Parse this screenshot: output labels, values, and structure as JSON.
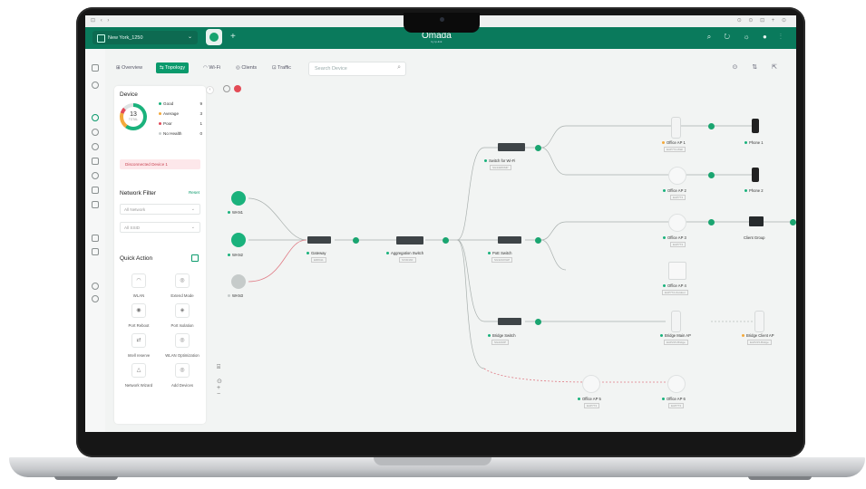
{
  "browser": {
    "left_icons": "⊡ ‹ ›",
    "right_icons": "⊙ ⊙ ⊡ + ⊙"
  },
  "header": {
    "site": "New York_1250",
    "brand": "Omada",
    "brand_sub": "by tp-link"
  },
  "tabs": [
    {
      "label": "Overview",
      "icon": "grid-icon"
    },
    {
      "label": "Topology",
      "icon": "topology-icon",
      "active": true
    },
    {
      "label": "Wi-Fi",
      "icon": "wifi-icon"
    },
    {
      "label": "Clients",
      "icon": "clients-icon"
    },
    {
      "label": "Traffic",
      "icon": "traffic-icon"
    }
  ],
  "search": {
    "placeholder": "Search Device"
  },
  "device_panel": {
    "title": "Device",
    "total": "13",
    "total_label": "TOTAL",
    "legend": [
      {
        "label": "Good",
        "value": "9",
        "color": "#1ab27c"
      },
      {
        "label": "Average",
        "value": "3",
        "color": "#f3a93c"
      },
      {
        "label": "Poor",
        "value": "1",
        "color": "#e24a5a"
      },
      {
        "label": "No Health",
        "value": "0",
        "color": "#c9cece"
      }
    ],
    "disconnected": "Disconnected Device 1"
  },
  "network_filter": {
    "title": "Network Filter",
    "reset": "Reset",
    "network": "All Network",
    "ssid": "All SSID"
  },
  "quick_action": {
    "title": "Quick Action",
    "items": [
      "WLAN",
      "Extend Mode",
      "Port Reboot",
      "Port Isolation",
      "Intell reserve",
      "WLAN Optimization",
      "Network Wizard",
      "Add Devices"
    ]
  },
  "topology": {
    "wans": [
      "WAN1",
      "WAN2",
      "WAN3"
    ],
    "gateway": {
      "label": "Gateway",
      "model": "ER8411"
    },
    "agg": {
      "label": "Aggregation Switch",
      "model": "SX3016F"
    },
    "switches": [
      {
        "label": "Switch for Wi-Fi",
        "model": "SG3428XMP"
      },
      {
        "label": "PoE Switch",
        "model": "SG3210XHP"
      },
      {
        "label": "Bridge Switch",
        "model": "SG2210P"
      }
    ],
    "aps": [
      {
        "label": "Office AP 1",
        "model": "EAP772-Wall"
      },
      {
        "label": "Office AP 2",
        "model": "EAP773"
      },
      {
        "label": "Office AP 3",
        "model": "EAP773"
      },
      {
        "label": "Office AP 4",
        "model": "EAP772-Outdoor"
      },
      {
        "label": "Bridge Main AP",
        "model": "EAP215-Bridge"
      },
      {
        "label": "Bridge Client AP",
        "model": "EAP215-Bridge"
      },
      {
        "label": "Office AP 5",
        "model": "EAP773"
      },
      {
        "label": "Office AP 6",
        "model": "EAP773"
      }
    ],
    "clients": [
      "Phone 1",
      "Phone 2",
      "Client Group"
    ]
  }
}
